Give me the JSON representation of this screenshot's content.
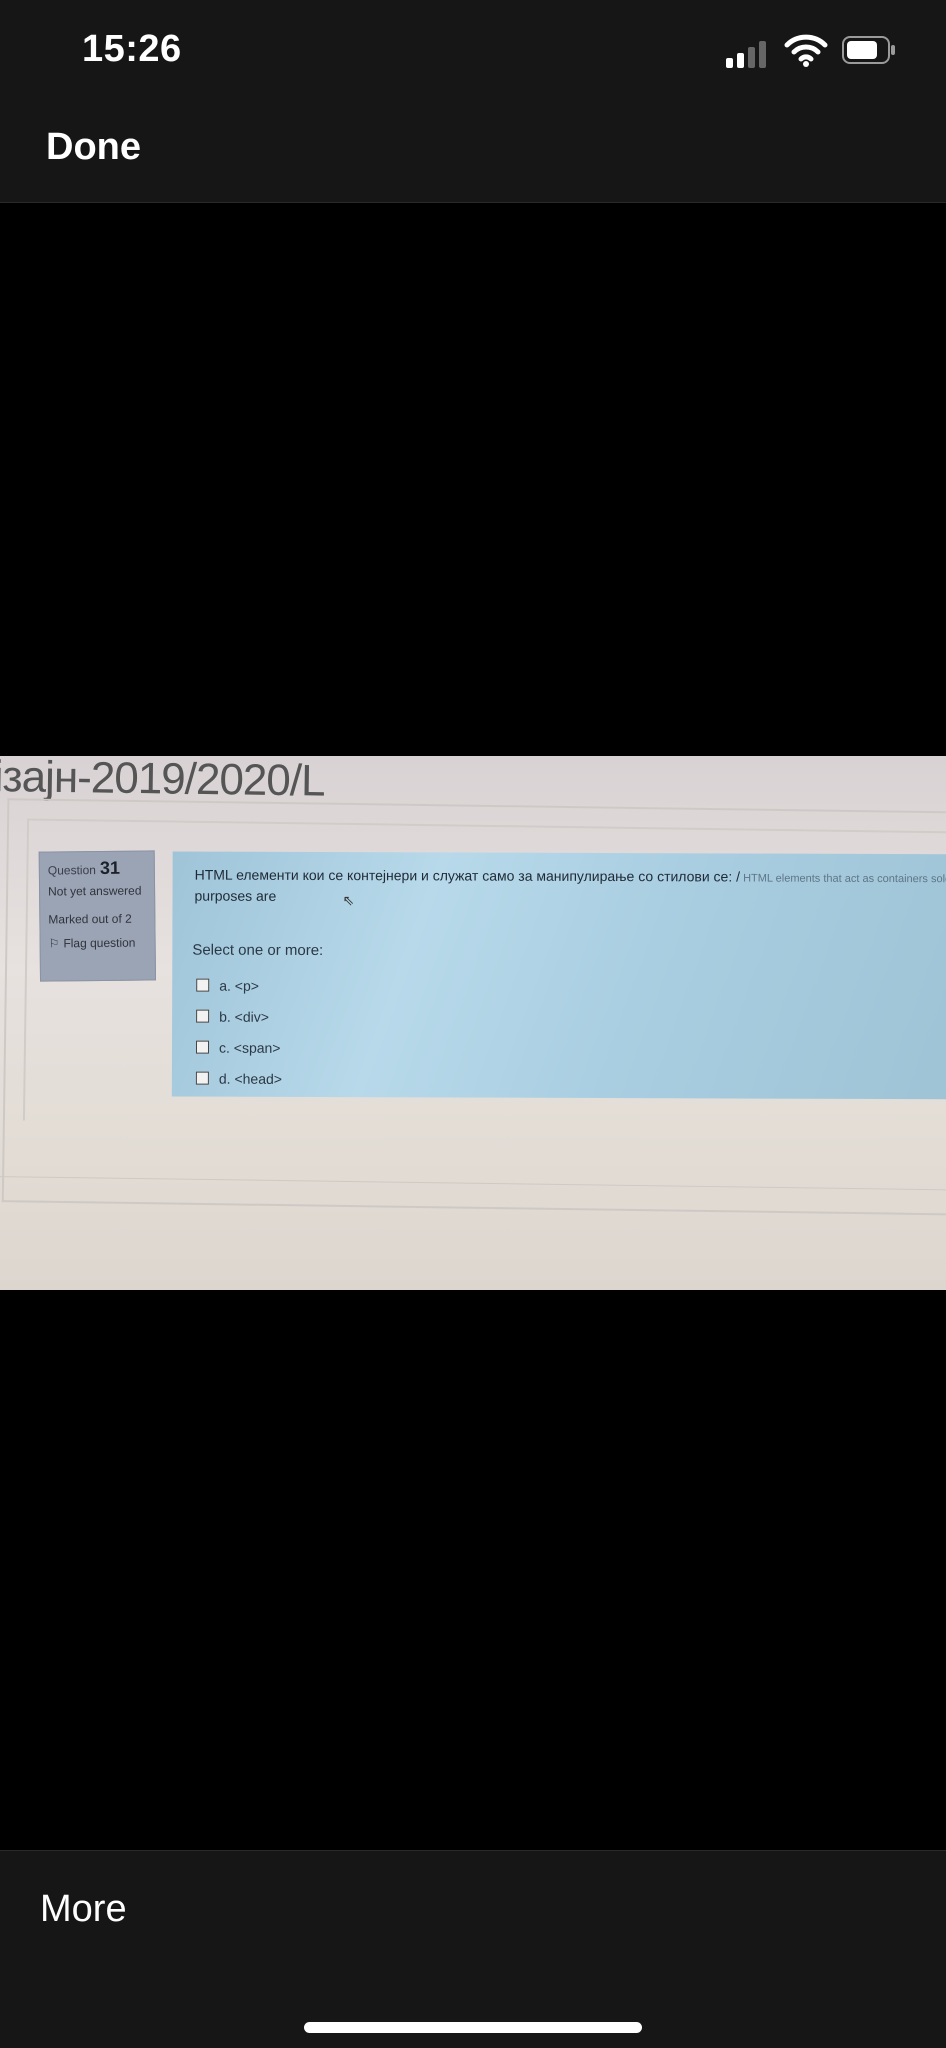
{
  "status_bar": {
    "time": "15:26",
    "icons": [
      "cellular-signal-icon",
      "wifi-icon",
      "battery-icon"
    ]
  },
  "nav": {
    "done_label": "Done"
  },
  "photo": {
    "course_title_fragment": "ізајн-2019/2020/L",
    "question_info": {
      "question_label": "Question",
      "question_number": "31",
      "state": "Not yet answered",
      "marks": "Marked out of 2",
      "flag_label": "Flag question"
    },
    "question": {
      "text_main": "HTML елементи кои се контејнери и служат само за манипулирање со стилови се: /",
      "text_faded": " HTML elements that act as containers solely fo",
      "text_line2": "purposes are",
      "prompt": "Select one or more:",
      "options": [
        {
          "letter": "a.",
          "label": "<p>"
        },
        {
          "letter": "b.",
          "label": "<div>"
        },
        {
          "letter": "c.",
          "label": "<span>"
        },
        {
          "letter": "d.",
          "label": "<head>"
        }
      ]
    }
  },
  "bottom_bar": {
    "more_label": "More"
  }
}
